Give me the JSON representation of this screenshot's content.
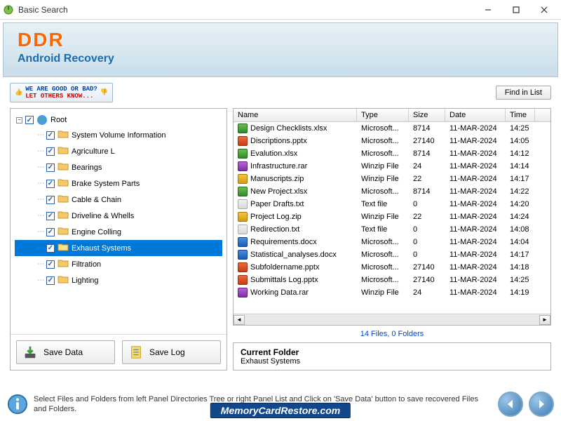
{
  "window": {
    "title": "Basic Search"
  },
  "banner": {
    "brand": "DDR",
    "subtitle": "Android Recovery"
  },
  "feedback": {
    "line1": "WE ARE GOOD OR BAD?",
    "line2": "LET OTHERS KNOW..."
  },
  "buttons": {
    "find_in_list": "Find in List",
    "save_data": "Save Data",
    "save_log": "Save Log"
  },
  "tree": {
    "root_label": "Root",
    "items": [
      {
        "label": "System Volume Information",
        "checked": true
      },
      {
        "label": "Agriculture L",
        "checked": true
      },
      {
        "label": "Bearings",
        "checked": true
      },
      {
        "label": "Brake System Parts",
        "checked": true
      },
      {
        "label": "Cable & Chain",
        "checked": true
      },
      {
        "label": "Driveline & Whells",
        "checked": true
      },
      {
        "label": "Engine Colling",
        "checked": true
      },
      {
        "label": "Exhaust Systems",
        "checked": true,
        "selected": true
      },
      {
        "label": "Filtration",
        "checked": true
      },
      {
        "label": "Lighting",
        "checked": true
      }
    ]
  },
  "columns": {
    "name": "Name",
    "type": "Type",
    "size": "Size",
    "date": "Date",
    "time": "Time"
  },
  "files": [
    {
      "name": "Design Checklists.xlsx",
      "type": "Microsoft...",
      "size": "8714",
      "date": "11-MAR-2024",
      "time": "14:25",
      "ext": "xlsx"
    },
    {
      "name": "Discriptions.pptx",
      "type": "Microsoft...",
      "size": "27140",
      "date": "11-MAR-2024",
      "time": "14:05",
      "ext": "pptx"
    },
    {
      "name": "Evalution.xlsx",
      "type": "Microsoft...",
      "size": "8714",
      "date": "11-MAR-2024",
      "time": "14:12",
      "ext": "xlsx"
    },
    {
      "name": "Infrastructure.rar",
      "type": "Winzip File",
      "size": "24",
      "date": "11-MAR-2024",
      "time": "14:14",
      "ext": "rar"
    },
    {
      "name": "Manuscripts.zip",
      "type": "Winzip File",
      "size": "22",
      "date": "11-MAR-2024",
      "time": "14:17",
      "ext": "zip"
    },
    {
      "name": "New Project.xlsx",
      "type": "Microsoft...",
      "size": "8714",
      "date": "11-MAR-2024",
      "time": "14:22",
      "ext": "xlsx"
    },
    {
      "name": "Paper Drafts.txt",
      "type": "Text file",
      "size": "0",
      "date": "11-MAR-2024",
      "time": "14:20",
      "ext": "txt"
    },
    {
      "name": "Project Log.zip",
      "type": "Winzip File",
      "size": "22",
      "date": "11-MAR-2024",
      "time": "14:24",
      "ext": "zip"
    },
    {
      "name": "Redirection.txt",
      "type": "Text file",
      "size": "0",
      "date": "11-MAR-2024",
      "time": "14:08",
      "ext": "txt"
    },
    {
      "name": "Requirements.docx",
      "type": "Microsoft...",
      "size": "0",
      "date": "11-MAR-2024",
      "time": "14:04",
      "ext": "docx"
    },
    {
      "name": "Statistical_analyses.docx",
      "type": "Microsoft...",
      "size": "0",
      "date": "11-MAR-2024",
      "time": "14:17",
      "ext": "docx"
    },
    {
      "name": "Subfoldername.pptx",
      "type": "Microsoft...",
      "size": "27140",
      "date": "11-MAR-2024",
      "time": "14:18",
      "ext": "pptx"
    },
    {
      "name": "Submittals Log.pptx",
      "type": "Microsoft...",
      "size": "27140",
      "date": "11-MAR-2024",
      "time": "14:25",
      "ext": "pptx"
    },
    {
      "name": "Working Data.rar",
      "type": "Winzip File",
      "size": "24",
      "date": "11-MAR-2024",
      "time": "14:19",
      "ext": "rar"
    }
  ],
  "summary": {
    "counts": "14 Files, 0 Folders",
    "current_label": "Current Folder",
    "current_value": "Exhaust Systems"
  },
  "footer": {
    "text": "Select Files and Folders from left Panel Directories Tree or right Panel List and Click on 'Save Data' button to save recovered Files and Folders."
  },
  "watermark": "MemoryCardRestore.com"
}
